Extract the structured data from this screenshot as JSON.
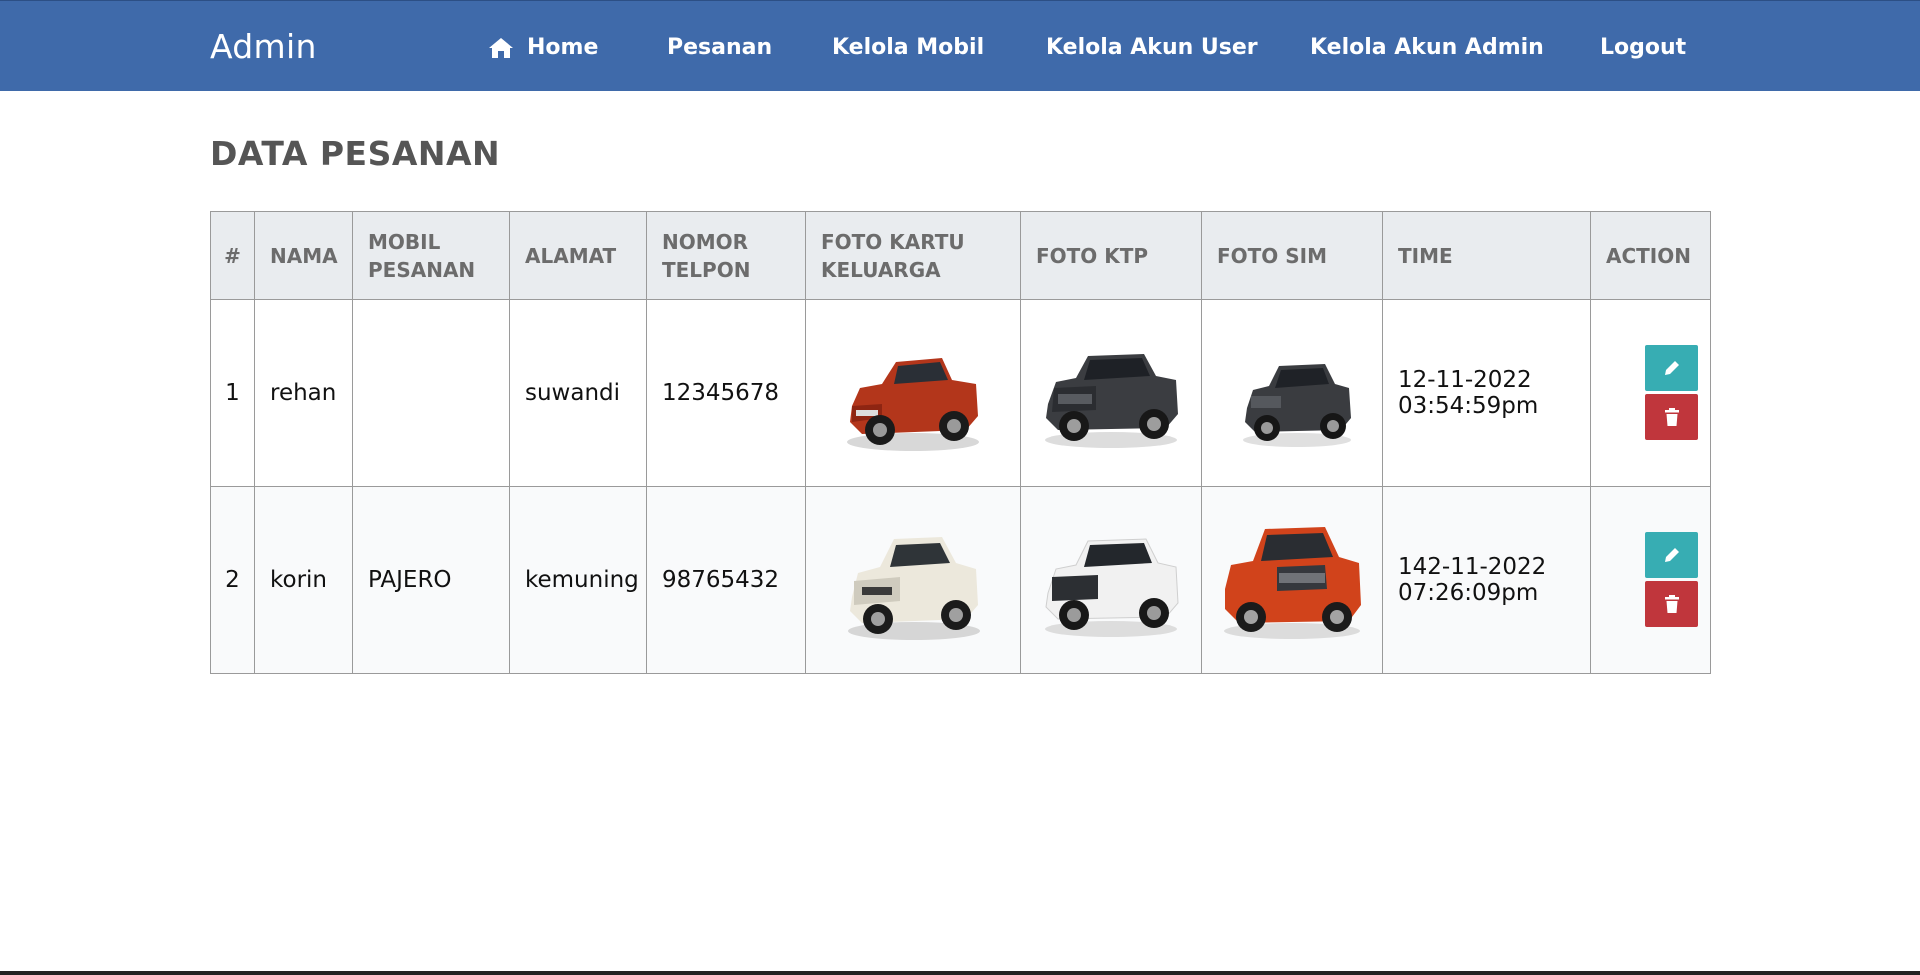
{
  "header": {
    "brand": "Admin",
    "nav": [
      {
        "label": "Home",
        "icon": "home-icon"
      },
      {
        "label": "Pesanan"
      },
      {
        "label": "Kelola Mobil"
      },
      {
        "label": "Kelola Akun User"
      },
      {
        "label": "Kelola Akun Admin"
      },
      {
        "label": "Logout"
      }
    ]
  },
  "main": {
    "title": "DATA PESANAN",
    "table": {
      "columns": [
        "#",
        "NAMA",
        "MOBIL PESANAN",
        "ALAMAT",
        "NOMOR TELPON",
        "FOTO KARTU KELUARGA",
        "FOTO KTP",
        "FOTO SIM",
        "TIME",
        "ACTION"
      ],
      "rows": [
        {
          "no": "1",
          "nama": "rehan",
          "mobil": "",
          "alamat": "suwandi",
          "telpon": "12345678",
          "foto_kk": "red pickup truck photo",
          "foto_ktp": "dark grey SUV photo",
          "foto_sim": "dark grey pickup truck photo",
          "time_date": "12-11-2022",
          "time_clock": "03:54:59pm"
        },
        {
          "no": "2",
          "nama": "korin",
          "mobil": "PAJERO",
          "alamat": "kemuning",
          "telpon": "98765432",
          "foto_kk": "white crossover SUV photo",
          "foto_ktp": "white SUV photo",
          "foto_sim": "orange pickup truck photo",
          "time_date": "142-11-2022",
          "time_clock": "07:26:09pm"
        }
      ]
    }
  },
  "colors": {
    "navbar": "#3f6aaa",
    "header_bg": "#e9ecef",
    "edit_button": "#37adb3",
    "delete_button": "#c0363c"
  },
  "icons": {
    "edit": "pencil-icon",
    "delete": "trash-icon"
  }
}
